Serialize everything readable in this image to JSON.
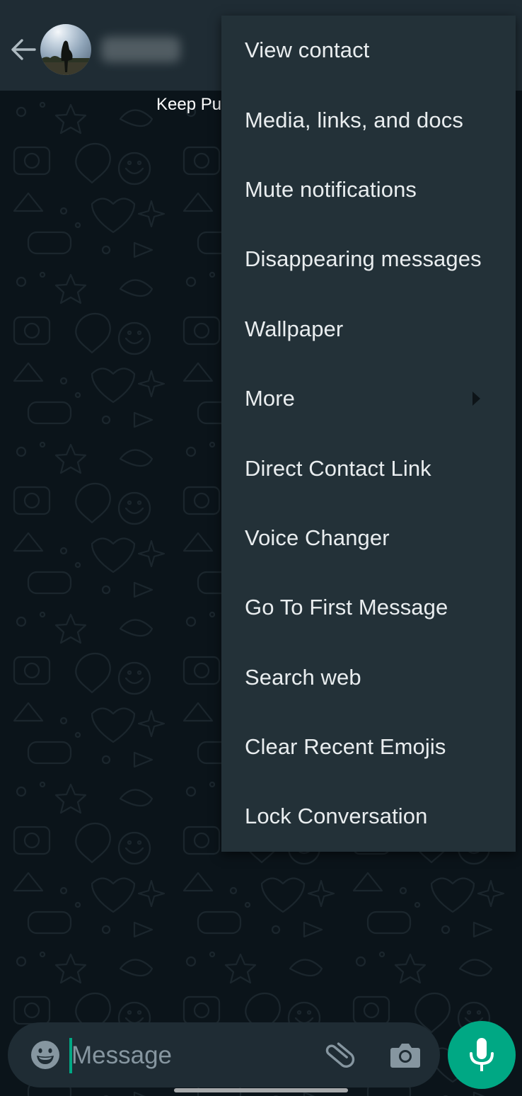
{
  "app": "WhatsApp",
  "header": {
    "back_icon": "arrow-left-icon",
    "avatar_icon": "contact-avatar",
    "contact_name_blurred": true
  },
  "chat": {
    "banner_text": "Keep Pu"
  },
  "menu": {
    "items": [
      {
        "label": "View contact",
        "has_submenu": false
      },
      {
        "label": "Media, links, and docs",
        "has_submenu": false
      },
      {
        "label": "Mute notifications",
        "has_submenu": false
      },
      {
        "label": "Disappearing messages",
        "has_submenu": false
      },
      {
        "label": "Wallpaper",
        "has_submenu": false
      },
      {
        "label": "More",
        "has_submenu": true,
        "submenu_icon": "triangle-right-icon"
      },
      {
        "label": "Direct Contact Link",
        "has_submenu": false
      },
      {
        "label": "Voice Changer",
        "has_submenu": false
      },
      {
        "label": "Go To First Message",
        "has_submenu": false
      },
      {
        "label": "Search web",
        "has_submenu": false
      },
      {
        "label": "Clear Recent Emojis",
        "has_submenu": false
      },
      {
        "label": "Lock Conversation",
        "has_submenu": false
      }
    ]
  },
  "composer": {
    "placeholder": "Message",
    "value": "",
    "emoji_icon": "smiley-icon",
    "attach_icon": "paperclip-icon",
    "camera_icon": "camera-icon",
    "mic_icon": "microphone-icon"
  },
  "colors": {
    "accent": "#00a884",
    "header_bg": "#1f2c34",
    "menu_bg": "#233138",
    "chat_bg": "#0b141a",
    "text_primary": "#e9edef",
    "icon_muted": "#8696a0"
  }
}
